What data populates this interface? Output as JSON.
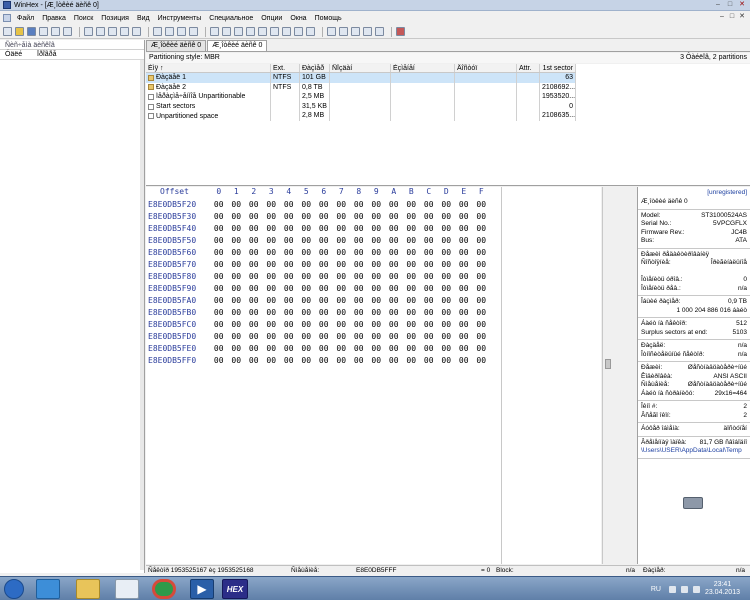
{
  "window": {
    "title": "WinHex - [Æ¸îòêèé äèñê 0]",
    "controls": {
      "minimize": "–",
      "maximize": "□",
      "close": "✕"
    }
  },
  "menu": [
    "Ôàéë",
    "Ïðàâêà",
    "Ïîèñê",
    "Ïîçèöèÿ",
    "Âèä",
    "Èíñòðóìåíòû",
    "Ñïåöèàëüíîå",
    "Îïöèè",
    "Îêíà",
    "Ïîìîùü"
  ],
  "menu_display": [
    "Файл",
    "Правка",
    "Поиск",
    "Позиция",
    "Вид",
    "Инструменты",
    "Специальное",
    "Опции",
    "Окна",
    "Помощь"
  ],
  "left_pane": {
    "header": "Ñèñ÷åìà äèñêîâ",
    "col1": "Óäëé",
    "col2": "Ïðîãðå"
  },
  "doc_tabs": [
    "Æ¸îòêèé äèñê 0",
    "Æ¸îòêèé äèñê 0"
  ],
  "partition": {
    "style_label": "Partitioning style: MBR",
    "summary": "3 Ôàéëîâ, 2 partitions",
    "columns": [
      "Èìÿ ↑",
      "Ext.",
      "Ðàçìåð",
      "Ñîçäàí",
      "Èçìåíåí",
      "Äîñòóï",
      "Attr.",
      "1st sector"
    ],
    "rows": [
      {
        "name": "Ðàçäåë 1",
        "ext": "NTFS",
        "size": "101 GB",
        "first": "63",
        "icon": "drive",
        "selected": true
      },
      {
        "name": "Ðàçäåë 2",
        "ext": "NTFS",
        "size": "0,8 TB",
        "first": "2108692...",
        "icon": "drive",
        "selected": false
      },
      {
        "name": "Íåðàçìå÷åííîå Unpartitionable",
        "ext": "",
        "size": "2,5 MB",
        "first": "1953520...",
        "icon": "file",
        "selected": false
      },
      {
        "name": "Start sectors",
        "ext": "",
        "size": "31,5 KB",
        "first": "0",
        "icon": "file",
        "selected": false
      },
      {
        "name": "Unpartitioned space",
        "ext": "",
        "size": "2,8 MB",
        "first": "2108635...",
        "icon": "file",
        "selected": false
      }
    ]
  },
  "hex": {
    "offset_label": "Offset",
    "columns": [
      "0",
      "1",
      "2",
      "3",
      "4",
      "5",
      "6",
      "7",
      "8",
      "9",
      "A",
      "B",
      "C",
      "D",
      "E",
      "F"
    ],
    "rows": [
      "E8E0DB5F20",
      "E8E0DB5F30",
      "E8E0DB5F40",
      "E8E0DB5F50",
      "E8E0DB5F60",
      "E8E0DB5F70",
      "E8E0DB5F80",
      "E8E0DB5F90",
      "E8E0DB5FA0",
      "E8E0DB5FB0",
      "E8E0DB5FC0",
      "E8E0DB5FD0",
      "E8E0DB5FE0",
      "E8E0DB5FF0"
    ],
    "byte": "00"
  },
  "info": {
    "unregistered": "[unregistered]",
    "disk_title": "Æ¸îòêèé äèñê 0",
    "sections": [
      [
        {
          "k": "Model:",
          "v": "ST31000524AS"
        },
        {
          "k": "Serial No.:",
          "v": "5VPCGFLX"
        },
        {
          "k": "Firmware Rev.:",
          "v": "JC4B"
        },
        {
          "k": "Bus:",
          "v": "ATA"
        }
      ],
      [
        {
          "k": "Ðåæèì ðåäàêòèðîâàíèÿ",
          "v": ""
        },
        {
          "k": "Ñîñòîÿíèå:",
          "v": "Îðèãèíàëüíîå"
        },
        {
          "k": "",
          "v": ""
        },
        {
          "k": "Îòìåíèòü óðîâ.:",
          "v": "0"
        },
        {
          "k": "Îòìåíèòü ðåâ.:",
          "v": "n/a"
        }
      ],
      [
        {
          "k": "Îáùèé ðàçìåð:",
          "v": "0,9 TB"
        },
        {
          "k": "",
          "v": "1 000 204 886 016 áàéò"
        }
      ],
      [
        {
          "k": "Áàéò íà ñåêòîð:",
          "v": "512"
        },
        {
          "k": "Surplus sectors at end:",
          "v": "5103"
        }
      ],
      [
        {
          "k": "Ðàçäåë:",
          "v": "n/a"
        },
        {
          "k": "Îòíîñèòåëüíûé ñåêòîð:",
          "v": "n/a"
        }
      ],
      [
        {
          "k": "Ðåæèì:",
          "v": "Øåñòíàäöàòåðè÷íûé"
        },
        {
          "k": "Êîäèðîâêà:",
          "v": "ANSI ASCII"
        },
        {
          "k": "Ñìåùåíèå:",
          "v": "Øåñòíàäöàòåðè÷íûé"
        },
        {
          "k": "Áàéò íà ñòðàíèöó:",
          "v": "29x16=464"
        }
      ],
      [
        {
          "k": "Îêíî #:",
          "v": "2"
        },
        {
          "k": "Âñåãî îêîí:",
          "v": "2"
        }
      ],
      [
        {
          "k": "Áóôåð îáìåíà:",
          "v": "äîñòóïåí"
        }
      ],
      [
        {
          "k": "Âðåìåííàÿ ïàïêà:",
          "v": "81,7 GB ñâîáîäíî"
        },
        {
          "k": "\\Users\\USER\\AppData\\Local\\Temp",
          "v": ""
        }
      ]
    ]
  },
  "status": {
    "sector": "Ñåêòîð 1953525167 èç 1953525168",
    "offset_label": "Ñìåùåíèå:",
    "offset_value": "E8E0DB5FFF",
    "value": "= 0",
    "block_label": "Block:",
    "block_value": "n/a",
    "size_label": "Ðàçìåð:",
    "size_value": "n/a"
  },
  "taskbar": {
    "lang": "RU",
    "time": "23:41",
    "date": "23.04.2013",
    "hex_label": "HEX"
  }
}
